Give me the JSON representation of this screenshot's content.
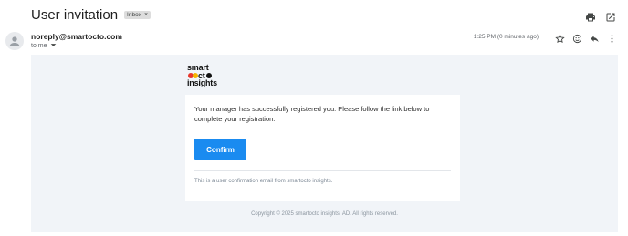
{
  "email": {
    "subject": "User invitation",
    "label": "Inbox",
    "sender": "noreply@smartocto.com",
    "to": "to me",
    "time": "1:25 PM (0 minutes ago)"
  },
  "logo": {
    "line1": "smart",
    "line2_prefix": "o",
    "line2_suffix": "ct",
    "line3": "insights",
    "colors": [
      "#e8372c",
      "#f5b400",
      "#111111"
    ]
  },
  "content": {
    "message": "Your manager has successfully registered you. Please follow the link below to complete your registration.",
    "button_label": "Confirm",
    "footnote": "This is a user confirmation email from smartocto insights.",
    "copyright": "Copyright © 2025 smartocto insights, AD. All rights reserved."
  },
  "icons": {
    "top": [
      "print-icon",
      "open-in-new-window-icon"
    ],
    "meta": [
      "star-icon",
      "emoji-icon",
      "reply-icon",
      "more-vert-icon"
    ]
  },
  "colors": {
    "accent": "#1a8bf0",
    "body_background": "#f1f4f8"
  }
}
